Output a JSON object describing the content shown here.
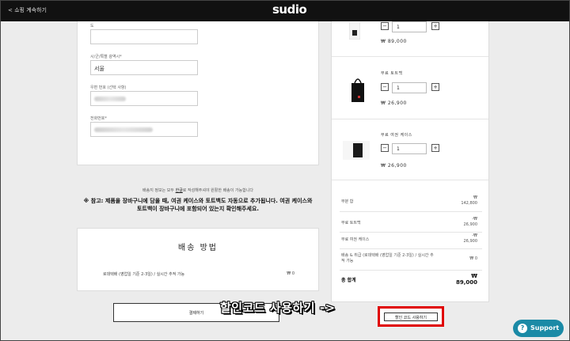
{
  "header": {
    "back_label": "< 쇼핑 계속하기",
    "logo": "sudio"
  },
  "form": {
    "province_label": "도",
    "city_label": "시/군/특별 광역시*",
    "city_value": "서울",
    "postal_label": "우편 번호 (선택 사항)",
    "phone_label": "전화번호*"
  },
  "notice": {
    "small_pre": "배송지 정보는 모두 ",
    "small_u": "한글",
    "small_post": "로 작성해주셔야 원활한 배송이 가능합니다",
    "bold": "※ 참고: 제품을 장바구니에 담을 때, 여권 케이스와 토트백도 자동으로 추가됩니다. 여권 케이스와 토트백이 장바구니에 포함되어 있는지 확인해주세요."
  },
  "shipping": {
    "title": "배송 방법",
    "option": "로데택배 (영업일 기준 2-3일) / 실시간 추적 가능",
    "price": "₩ 0"
  },
  "pay_button": "결제하기",
  "cart": {
    "items": [
      {
        "name": "",
        "qty": "1",
        "price": "₩ 89,000",
        "icon": "earbuds-case-image"
      },
      {
        "name": "무료 토트백",
        "qty": "1",
        "price": "₩ 26,900",
        "icon": "tote-bag-image"
      },
      {
        "name": "무료 여권 케이스",
        "qty": "1",
        "price": "₩ 26,900",
        "icon": "passport-case-image"
      }
    ],
    "summary": [
      {
        "label": "부분 합",
        "value_top": "₩",
        "value": "142,800"
      },
      {
        "label": "무료 토트백",
        "value_top": "-₩",
        "value": "26,900"
      },
      {
        "label": "무료 여권 케이스",
        "value_top": "-₩",
        "value": "26,900"
      },
      {
        "label": "배송 & 취급 (로데택배 (영업일 기준 2-3일) / 실시간 추적 가능",
        "value_top": "",
        "value": "₩ 0"
      }
    ],
    "total_label": "총 합계",
    "total_currency": "₩",
    "total_value": "89,000"
  },
  "overlay": {
    "text": "할인코드 사용하기 ->"
  },
  "coupon_button": "할인 코드 사용하기",
  "support": {
    "label": "Support"
  },
  "colors": {
    "header_bg": "#111111",
    "highlight": "#e00000",
    "support_bg": "#1b8aa6"
  }
}
